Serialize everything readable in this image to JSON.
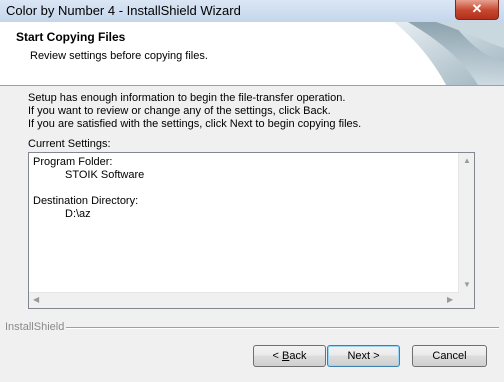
{
  "window": {
    "title": "Color by Number 4 - InstallShield Wizard",
    "close_glyph": "✕"
  },
  "header": {
    "title": "Start Copying Files",
    "subtitle": "Review settings before copying files."
  },
  "body": {
    "lines": [
      "Setup has enough information to begin the file-transfer operation.",
      "If you want to review or change any of the settings, click Back.",
      "If you are satisfied with the settings, click Next to begin copying files."
    ],
    "current_settings_label": "Current Settings:"
  },
  "settings": {
    "program_folder_label": "Program Folder:",
    "program_folder_value": "STOIK Software",
    "destination_label": "Destination Directory:",
    "destination_value": "D:\\az"
  },
  "footer": {
    "brand": "InstallShield"
  },
  "buttons": {
    "back_prefix": "< ",
    "back_mnemonic": "B",
    "back_rest": "ack",
    "next": "Next >",
    "cancel": "Cancel"
  }
}
